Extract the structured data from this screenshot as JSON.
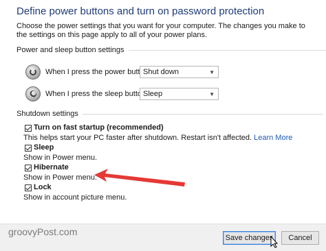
{
  "title": "Define power buttons and turn on password protection",
  "description": "Choose the power settings that you want for your computer. The changes you make to the settings on this page apply to all of your power plans.",
  "power_sleep": {
    "heading": "Power and sleep button settings",
    "power_label": "When I press the power button:",
    "power_value": "Shut down",
    "sleep_label": "When I press the sleep button:",
    "sleep_value": "Sleep"
  },
  "shutdown": {
    "heading": "Shutdown settings",
    "items": [
      {
        "name": "Turn on fast startup (recommended)",
        "desc": "This helps start your PC faster after shutdown. Restart isn't affected.",
        "link": "Learn More",
        "checked": true
      },
      {
        "name": "Sleep",
        "desc": "Show in Power menu.",
        "checked": true
      },
      {
        "name": "Hibernate",
        "desc": "Show in Power menu.",
        "checked": true
      },
      {
        "name": "Lock",
        "desc": "Show in account picture menu.",
        "checked": true
      }
    ]
  },
  "footer": {
    "watermark": "groovyPost.com",
    "save_label": "Save changes",
    "cancel_label": "Cancel"
  },
  "colors": {
    "title": "#1e3c78",
    "link": "#1e5ab4",
    "arrow": "#e53935"
  }
}
